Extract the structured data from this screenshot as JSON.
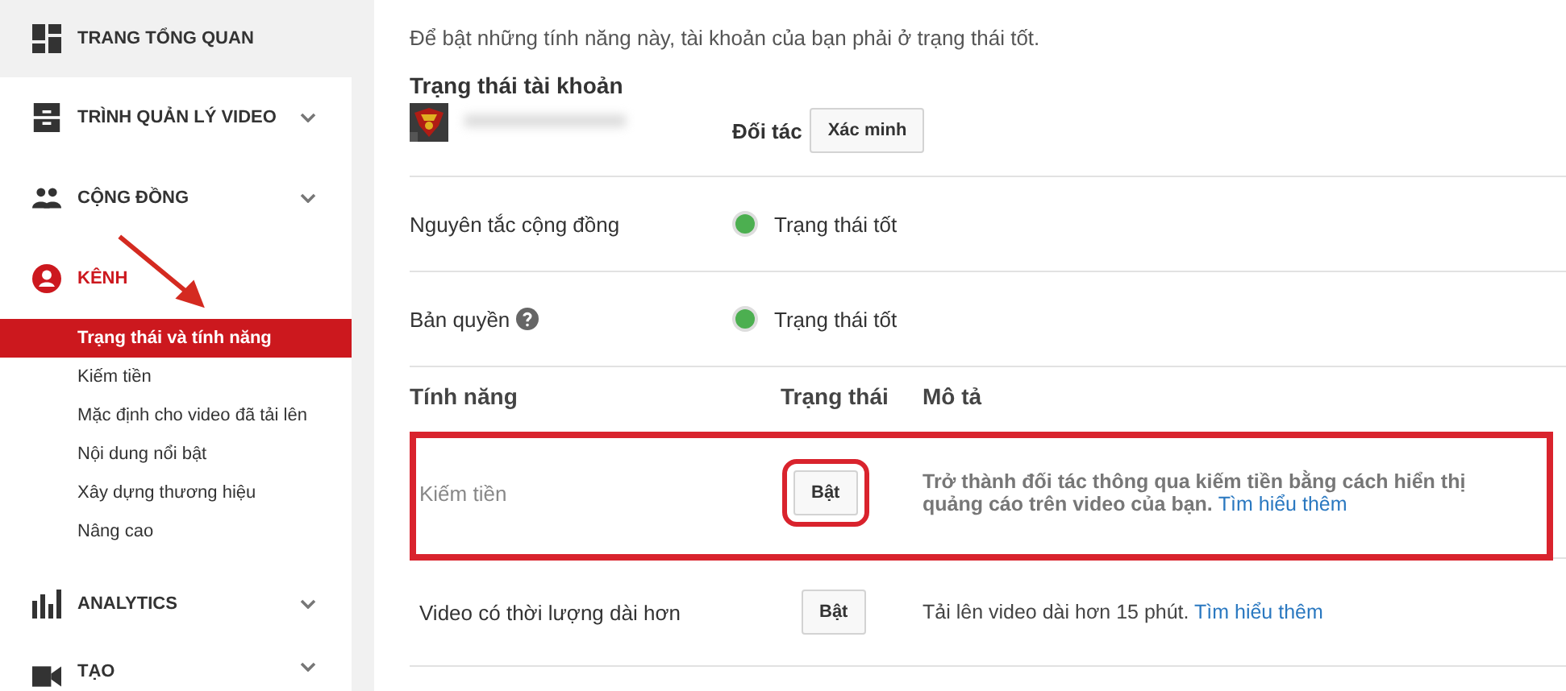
{
  "sidebar": {
    "items": [
      {
        "label": "TRANG TỔNG QUAN",
        "selected": false,
        "expandable": false
      },
      {
        "label": "TRÌNH QUẢN LÝ VIDEO",
        "selected": false,
        "expandable": true
      },
      {
        "label": "CỘNG ĐỒNG",
        "selected": false,
        "expandable": true
      },
      {
        "label": "KÊNH",
        "selected": true,
        "expandable": false,
        "children": [
          {
            "label": "Trạng thái và tính năng",
            "selected": true
          },
          {
            "label": "Kiếm tiền",
            "selected": false
          },
          {
            "label": "Mặc định cho video đã tải lên",
            "selected": false
          },
          {
            "label": "Nội dung nổi bật",
            "selected": false
          },
          {
            "label": "Xây dựng thương hiệu",
            "selected": false
          },
          {
            "label": "Nâng cao",
            "selected": false
          }
        ]
      },
      {
        "label": "ANALYTICS",
        "selected": false,
        "expandable": true
      },
      {
        "label": "TẠO",
        "selected": false,
        "expandable": true
      }
    ]
  },
  "intro": "Để bật những tính năng này, tài khoản của bạn phải ở trạng thái tốt.",
  "account": {
    "heading": "Trạng thái tài khoản",
    "status": "Đối tác",
    "verify_button": "Xác minh"
  },
  "standing": [
    {
      "label": "Nguyên tắc cộng đồng",
      "help": false,
      "status": "Trạng thái tốt",
      "color": "#4caf50"
    },
    {
      "label": "Bản quyền",
      "help": true,
      "status": "Trạng thái tốt",
      "color": "#4caf50"
    }
  ],
  "features": {
    "columns": [
      "Tính năng",
      "Trạng thái",
      "Mô tả"
    ],
    "rows": [
      {
        "name": "Kiếm tiền",
        "button": "Bật",
        "description": "Trở thành đối tác thông qua kiếm tiền bằng cách hiển thị quảng cáo trên video của bạn.",
        "link": "Tìm hiểu thêm",
        "highlighted": true
      },
      {
        "name": "Video có thời lượng dài hơn",
        "button": "Bật",
        "description": "Tải lên video dài hơn 15 phút.",
        "link": "Tìm hiểu thêm",
        "highlighted": false
      }
    ]
  }
}
